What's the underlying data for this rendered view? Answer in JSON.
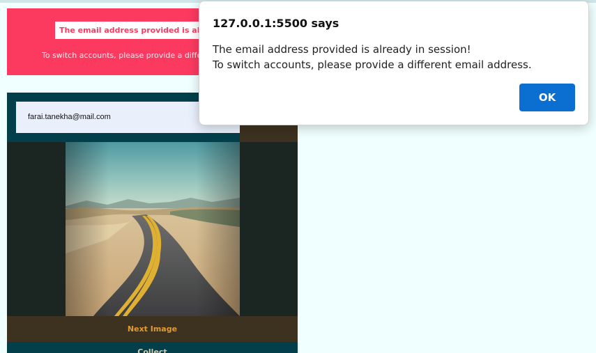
{
  "error_banner": {
    "message": "The email address provided is already in session!",
    "subtext": "To switch accounts, please provide a different email address."
  },
  "card": {
    "email": "farai.tanekha@mail.com",
    "image_alt": "desert road photo",
    "next_button": "Next Image",
    "collect_button": "Collect"
  },
  "dialog": {
    "title": "127.0.0.1:5500 says",
    "message_line1": "The email address provided is already in session!",
    "message_line2": "To switch accounts, please provide a different email address.",
    "ok_button": "OK"
  },
  "colors": {
    "background": "#f0ffff",
    "error_banner": "#fc3a60",
    "card": "#033f4a",
    "button_bar": "#3d3220",
    "accent_text": "#e09a33",
    "ok_button": "#0b6fd1"
  }
}
